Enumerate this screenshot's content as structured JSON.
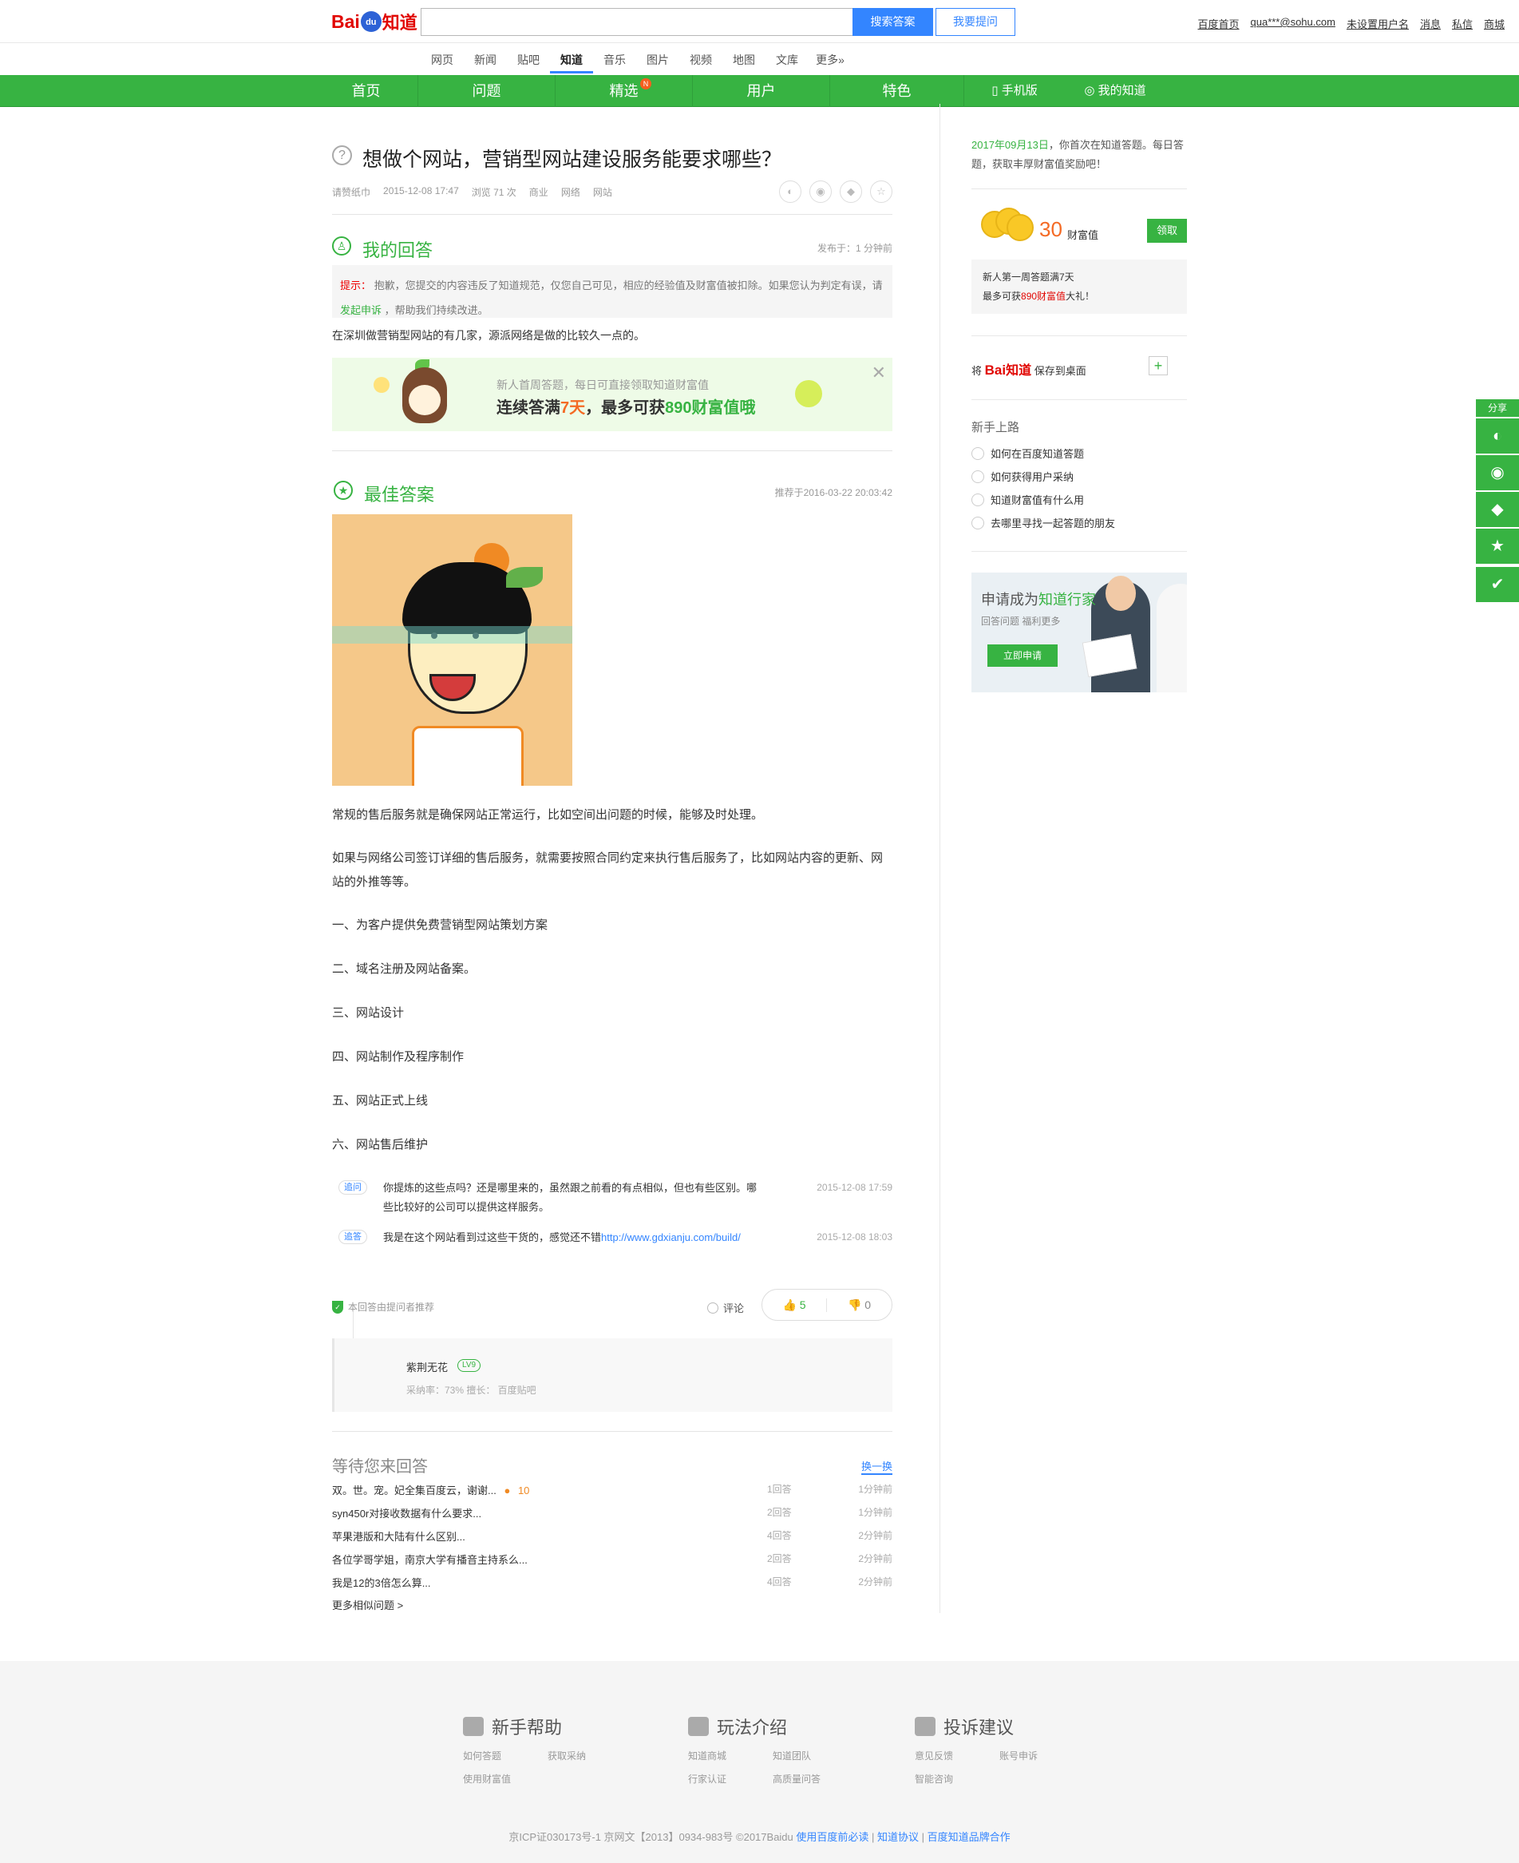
{
  "header": {
    "logo": {
      "bai": "Bai",
      "du": "du",
      "zhidao": "知道"
    },
    "search_placeholder": "",
    "search_button": "搜索答案",
    "ask_button": "我要提问",
    "links": [
      "百度首页",
      "qua***@sohu.com",
      "未设置用户名",
      "消息",
      "私信",
      "商城"
    ]
  },
  "channels": [
    "网页",
    "新闻",
    "贴吧",
    "知道",
    "音乐",
    "图片",
    "视频",
    "地图",
    "文库",
    "更多»"
  ],
  "greennav": {
    "items": [
      "首页",
      "问题",
      "精选",
      "用户",
      "特色"
    ],
    "badge": "N",
    "mobile": "手机版",
    "my": "我的知道"
  },
  "question": {
    "title": "想做个网站，营销型网站建设服务能要求哪些？",
    "meta": [
      "请赞纸巾",
      "2015-12-08 17:47",
      "浏览 71 次",
      "商业",
      "网络",
      "网站"
    ]
  },
  "my_answer": {
    "title": "我的回答",
    "time": "发布于：1 分钟前",
    "tip_key": "提示：",
    "tip_text": "抱歉，您提交的内容违反了知道规范，仅您自己可见，相应的经验值及财富值被扣除。如果您认为判定有误，请",
    "tip_link": "发起申诉",
    "tip_end": "，帮助我们持续改进。",
    "content": "在深圳做营销型网站的有几家，源派网络是做的比较久一点的。"
  },
  "banner": {
    "small": "新人首周答题，每日可直接领取知道财富值",
    "big_pre": "连续答满",
    "big_days": "7天",
    "big_mid": "，最多可获",
    "big_amount": "890财富值哦"
  },
  "best_answer": {
    "title": "最佳答案",
    "time": "推荐于2016-03-22 20:03:42",
    "paragraphs": [
      "常规的售后服务就是确保网站正常运行，比如空间出问题的时候，能够及时处理。",
      "如果与网络公司签订详细的售后服务，就需要按照合同约定来执行售后服务了，比如网站内容的更新、网站的外推等等。",
      "一、为客户提供免费营销型网站策划方案",
      "二、域名注册及网站备案。",
      "三、网站设计",
      "四、网站制作及程序制作",
      "五、网站正式上线",
      "六、网站售后维护"
    ],
    "followups": [
      {
        "tag": "追问",
        "text": "你提炼的这些点吗？还是哪里来的，虽然跟之前看的有点相似，但也有些区别。哪些比较好的公司可以提供这样服务。",
        "time": "2015-12-08 17:59"
      },
      {
        "tag": "追答",
        "text": "我是在这个网站看到过这些干货的，感觉还不错",
        "link": "http://www.gdxianju.com/build/",
        "time": "2015-12-08 18:03"
      }
    ],
    "recommend": "本回答由提问者推荐",
    "comment": "评论",
    "up": "5",
    "down": "0",
    "user": {
      "name": "紫荆无花",
      "level": "LV9",
      "stats": "采纳率：73%    擅长：  百度贴吧"
    }
  },
  "waiting": {
    "title": "等待您来回答",
    "switch": "换一换",
    "rows": [
      {
        "q": "双。世。宠。妃全集百度云，谢谢...",
        "coin": "10",
        "count": "1回答",
        "time": "1分钟前"
      },
      {
        "q": "syn450r对接收数据有什么要求...",
        "count": "2回答",
        "time": "1分钟前"
      },
      {
        "q": "苹果港版和大陆有什么区别...",
        "count": "4回答",
        "time": "2分钟前"
      },
      {
        "q": "各位学哥学姐，南京大学有播音主持系么...",
        "count": "2回答",
        "time": "2分钟前"
      },
      {
        "q": "我是12的3倍怎么算...",
        "count": "4回答",
        "time": "2分钟前"
      }
    ],
    "more": "更多相似问题 >"
  },
  "sidebar": {
    "first_date": "2017年09月13日",
    "first_text": "，你首次在知道答题。每日答题，获取丰厚财富值奖励吧！",
    "amount": "30",
    "amount_label": "财富值",
    "claim": "领取",
    "newbie_line1": "新人第一周答题满7天",
    "newbie_pre": "最多可获",
    "newbie_red": "890财富值",
    "newbie_post": "大礼！",
    "save_pre": "将",
    "save_bai": "Bai",
    "save_zd": "知道",
    "save_post": "保存到桌面",
    "guide_title": "新手上路",
    "guides": [
      "如何在百度知道答题",
      "如何获得用户采纳",
      "知道财富值有什么用",
      "去哪里寻找一起答题的朋友"
    ],
    "promo_title_pre": "申请成为",
    "promo_title_green": "知道行家",
    "promo_sub": "回答问题  福利更多",
    "promo_btn": "立即申请"
  },
  "float_share": {
    "label": "分享"
  },
  "footer": {
    "cols": [
      {
        "title": "新手帮助",
        "links": [
          "如何答题",
          "获取采纳",
          "使用财富值"
        ]
      },
      {
        "title": "玩法介绍",
        "links": [
          "知道商城",
          "知道团队",
          "行家认证",
          "高质量问答"
        ]
      },
      {
        "title": "投诉建议",
        "links": [
          "意见反馈",
          "账号申诉",
          "智能咨询"
        ]
      }
    ],
    "copyright": "京ICP证030173号-1    京网文【2013】0934-983号     ©2017Baidu",
    "blue_links": [
      "使用百度前必读",
      "知道协议",
      "百度知道品牌合作"
    ]
  }
}
